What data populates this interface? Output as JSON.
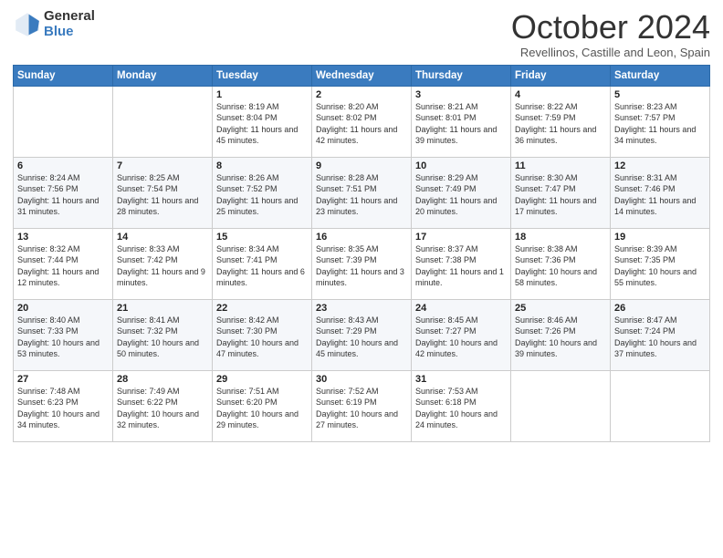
{
  "logo": {
    "general": "General",
    "blue": "Blue"
  },
  "title": "October 2024",
  "subtitle": "Revellinos, Castille and Leon, Spain",
  "days_of_week": [
    "Sunday",
    "Monday",
    "Tuesday",
    "Wednesday",
    "Thursday",
    "Friday",
    "Saturday"
  ],
  "weeks": [
    [
      {
        "day": "",
        "sunrise": "",
        "sunset": "",
        "daylight": ""
      },
      {
        "day": "",
        "sunrise": "",
        "sunset": "",
        "daylight": ""
      },
      {
        "day": "1",
        "sunrise": "Sunrise: 8:19 AM",
        "sunset": "Sunset: 8:04 PM",
        "daylight": "Daylight: 11 hours and 45 minutes."
      },
      {
        "day": "2",
        "sunrise": "Sunrise: 8:20 AM",
        "sunset": "Sunset: 8:02 PM",
        "daylight": "Daylight: 11 hours and 42 minutes."
      },
      {
        "day": "3",
        "sunrise": "Sunrise: 8:21 AM",
        "sunset": "Sunset: 8:01 PM",
        "daylight": "Daylight: 11 hours and 39 minutes."
      },
      {
        "day": "4",
        "sunrise": "Sunrise: 8:22 AM",
        "sunset": "Sunset: 7:59 PM",
        "daylight": "Daylight: 11 hours and 36 minutes."
      },
      {
        "day": "5",
        "sunrise": "Sunrise: 8:23 AM",
        "sunset": "Sunset: 7:57 PM",
        "daylight": "Daylight: 11 hours and 34 minutes."
      }
    ],
    [
      {
        "day": "6",
        "sunrise": "Sunrise: 8:24 AM",
        "sunset": "Sunset: 7:56 PM",
        "daylight": "Daylight: 11 hours and 31 minutes."
      },
      {
        "day": "7",
        "sunrise": "Sunrise: 8:25 AM",
        "sunset": "Sunset: 7:54 PM",
        "daylight": "Daylight: 11 hours and 28 minutes."
      },
      {
        "day": "8",
        "sunrise": "Sunrise: 8:26 AM",
        "sunset": "Sunset: 7:52 PM",
        "daylight": "Daylight: 11 hours and 25 minutes."
      },
      {
        "day": "9",
        "sunrise": "Sunrise: 8:28 AM",
        "sunset": "Sunset: 7:51 PM",
        "daylight": "Daylight: 11 hours and 23 minutes."
      },
      {
        "day": "10",
        "sunrise": "Sunrise: 8:29 AM",
        "sunset": "Sunset: 7:49 PM",
        "daylight": "Daylight: 11 hours and 20 minutes."
      },
      {
        "day": "11",
        "sunrise": "Sunrise: 8:30 AM",
        "sunset": "Sunset: 7:47 PM",
        "daylight": "Daylight: 11 hours and 17 minutes."
      },
      {
        "day": "12",
        "sunrise": "Sunrise: 8:31 AM",
        "sunset": "Sunset: 7:46 PM",
        "daylight": "Daylight: 11 hours and 14 minutes."
      }
    ],
    [
      {
        "day": "13",
        "sunrise": "Sunrise: 8:32 AM",
        "sunset": "Sunset: 7:44 PM",
        "daylight": "Daylight: 11 hours and 12 minutes."
      },
      {
        "day": "14",
        "sunrise": "Sunrise: 8:33 AM",
        "sunset": "Sunset: 7:42 PM",
        "daylight": "Daylight: 11 hours and 9 minutes."
      },
      {
        "day": "15",
        "sunrise": "Sunrise: 8:34 AM",
        "sunset": "Sunset: 7:41 PM",
        "daylight": "Daylight: 11 hours and 6 minutes."
      },
      {
        "day": "16",
        "sunrise": "Sunrise: 8:35 AM",
        "sunset": "Sunset: 7:39 PM",
        "daylight": "Daylight: 11 hours and 3 minutes."
      },
      {
        "day": "17",
        "sunrise": "Sunrise: 8:37 AM",
        "sunset": "Sunset: 7:38 PM",
        "daylight": "Daylight: 11 hours and 1 minute."
      },
      {
        "day": "18",
        "sunrise": "Sunrise: 8:38 AM",
        "sunset": "Sunset: 7:36 PM",
        "daylight": "Daylight: 10 hours and 58 minutes."
      },
      {
        "day": "19",
        "sunrise": "Sunrise: 8:39 AM",
        "sunset": "Sunset: 7:35 PM",
        "daylight": "Daylight: 10 hours and 55 minutes."
      }
    ],
    [
      {
        "day": "20",
        "sunrise": "Sunrise: 8:40 AM",
        "sunset": "Sunset: 7:33 PM",
        "daylight": "Daylight: 10 hours and 53 minutes."
      },
      {
        "day": "21",
        "sunrise": "Sunrise: 8:41 AM",
        "sunset": "Sunset: 7:32 PM",
        "daylight": "Daylight: 10 hours and 50 minutes."
      },
      {
        "day": "22",
        "sunrise": "Sunrise: 8:42 AM",
        "sunset": "Sunset: 7:30 PM",
        "daylight": "Daylight: 10 hours and 47 minutes."
      },
      {
        "day": "23",
        "sunrise": "Sunrise: 8:43 AM",
        "sunset": "Sunset: 7:29 PM",
        "daylight": "Daylight: 10 hours and 45 minutes."
      },
      {
        "day": "24",
        "sunrise": "Sunrise: 8:45 AM",
        "sunset": "Sunset: 7:27 PM",
        "daylight": "Daylight: 10 hours and 42 minutes."
      },
      {
        "day": "25",
        "sunrise": "Sunrise: 8:46 AM",
        "sunset": "Sunset: 7:26 PM",
        "daylight": "Daylight: 10 hours and 39 minutes."
      },
      {
        "day": "26",
        "sunrise": "Sunrise: 8:47 AM",
        "sunset": "Sunset: 7:24 PM",
        "daylight": "Daylight: 10 hours and 37 minutes."
      }
    ],
    [
      {
        "day": "27",
        "sunrise": "Sunrise: 7:48 AM",
        "sunset": "Sunset: 6:23 PM",
        "daylight": "Daylight: 10 hours and 34 minutes."
      },
      {
        "day": "28",
        "sunrise": "Sunrise: 7:49 AM",
        "sunset": "Sunset: 6:22 PM",
        "daylight": "Daylight: 10 hours and 32 minutes."
      },
      {
        "day": "29",
        "sunrise": "Sunrise: 7:51 AM",
        "sunset": "Sunset: 6:20 PM",
        "daylight": "Daylight: 10 hours and 29 minutes."
      },
      {
        "day": "30",
        "sunrise": "Sunrise: 7:52 AM",
        "sunset": "Sunset: 6:19 PM",
        "daylight": "Daylight: 10 hours and 27 minutes."
      },
      {
        "day": "31",
        "sunrise": "Sunrise: 7:53 AM",
        "sunset": "Sunset: 6:18 PM",
        "daylight": "Daylight: 10 hours and 24 minutes."
      },
      {
        "day": "",
        "sunrise": "",
        "sunset": "",
        "daylight": ""
      },
      {
        "day": "",
        "sunrise": "",
        "sunset": "",
        "daylight": ""
      }
    ]
  ]
}
